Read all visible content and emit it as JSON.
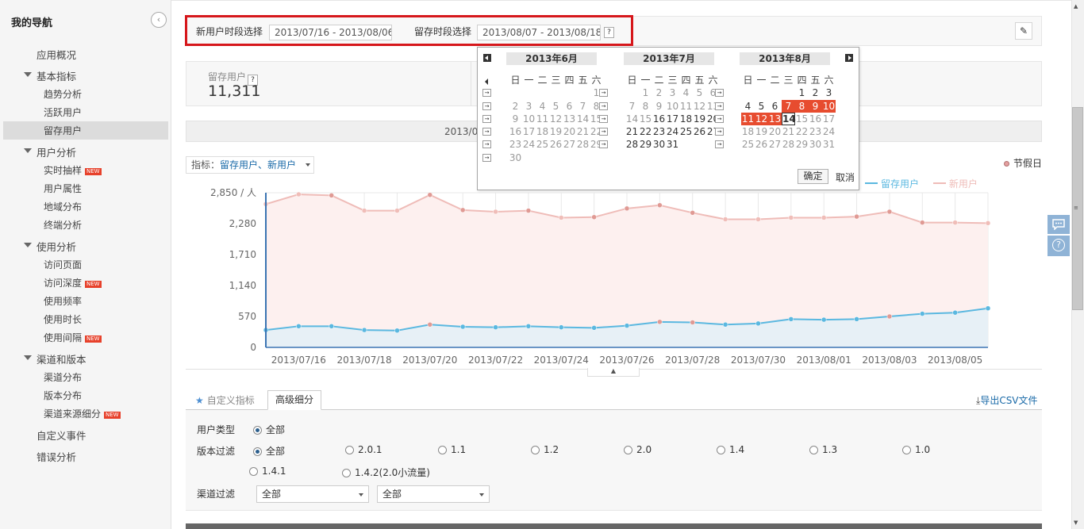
{
  "sidebar": {
    "title": "我的导航",
    "collapse_icon": "‹",
    "items": [
      {
        "label": "应用概况",
        "level": 1,
        "top": 59
      },
      {
        "label": "基本指标",
        "level": 1,
        "group": true,
        "top": 86
      },
      {
        "label": "趋势分析",
        "level": 2,
        "top": 110
      },
      {
        "label": "活跃用户",
        "level": 2,
        "top": 133
      },
      {
        "label": "留存用户",
        "level": 2,
        "active": true,
        "top": 156
      },
      {
        "label": "用户分析",
        "level": 1,
        "group": true,
        "top": 182
      },
      {
        "label": "实时抽样",
        "level": 2,
        "badge": "NEW",
        "top": 206
      },
      {
        "label": "用户属性",
        "level": 2,
        "top": 229
      },
      {
        "label": "地域分布",
        "level": 2,
        "top": 252
      },
      {
        "label": "终端分析",
        "level": 2,
        "top": 275
      },
      {
        "label": "使用分析",
        "level": 1,
        "group": true,
        "top": 301
      },
      {
        "label": "访问页面",
        "level": 2,
        "top": 325
      },
      {
        "label": "访问深度",
        "level": 2,
        "badge": "NEW",
        "top": 348
      },
      {
        "label": "使用频率",
        "level": 2,
        "top": 371
      },
      {
        "label": "使用时长",
        "level": 2,
        "top": 394
      },
      {
        "label": "使用间隔",
        "level": 2,
        "badge": "NEW",
        "top": 417
      },
      {
        "label": "渠道和版本",
        "level": 1,
        "group": true,
        "top": 443
      },
      {
        "label": "渠道分布",
        "level": 2,
        "top": 467
      },
      {
        "label": "版本分布",
        "level": 2,
        "top": 490
      },
      {
        "label": "渠道来源细分",
        "level": 2,
        "badge": "NEW",
        "top": 513
      },
      {
        "label": "自定义事件",
        "level": 1,
        "top": 539
      },
      {
        "label": "错误分析",
        "level": 1,
        "top": 566
      }
    ]
  },
  "filters": {
    "new_user_label": "新用户时段选择",
    "new_user_range": "2013/07/16 - 2013/08/06",
    "retention_label": "留存时段选择",
    "retention_range": "2013/08/07 - 2013/08/18",
    "help_icon": "?",
    "pin_icon": "✎"
  },
  "stat": {
    "label": "留存用户",
    "help_icon": "?",
    "value": "11,311"
  },
  "datebar_text": "2013/0",
  "metric": {
    "key": "指标：",
    "value": "留存用户、新用户"
  },
  "holiday_label": "节假日",
  "legend": {
    "retention": "留存用户",
    "new_users": "新用户"
  },
  "colors": {
    "retention": "#5bb8e0",
    "new_users": "#efbcb8",
    "accent_red": "#e74c2f",
    "link": "#1a6aa8"
  },
  "chart_data": {
    "type": "line",
    "y_ticks": [
      "0",
      "570",
      "1,140",
      "1,710",
      "2,280",
      "2,850 / 人"
    ],
    "ylim": [
      0,
      2850
    ],
    "x_ticks": [
      "2013/07/16",
      "2013/07/18",
      "2013/07/20",
      "2013/07/22",
      "2013/07/24",
      "2013/07/26",
      "2013/07/28",
      "2013/07/30",
      "2013/08/01",
      "2013/08/03",
      "2013/08/05"
    ],
    "x": [
      "2013/07/15",
      "2013/07/16",
      "2013/07/17",
      "2013/07/18",
      "2013/07/19",
      "2013/07/20",
      "2013/07/21",
      "2013/07/22",
      "2013/07/23",
      "2013/07/24",
      "2013/07/25",
      "2013/07/26",
      "2013/07/27",
      "2013/07/28",
      "2013/07/29",
      "2013/07/30",
      "2013/07/31",
      "2013/08/01",
      "2013/08/02",
      "2013/08/03",
      "2013/08/04",
      "2013/08/05",
      "2013/08/06"
    ],
    "series": [
      {
        "name": "新用户",
        "values": [
          2640,
          2820,
          2800,
          2520,
          2520,
          2810,
          2530,
          2500,
          2520,
          2390,
          2400,
          2560,
          2620,
          2480,
          2360,
          2360,
          2390,
          2390,
          2410,
          2500,
          2300,
          2300,
          2290
        ]
      },
      {
        "name": "留存用户",
        "values": [
          320,
          390,
          390,
          320,
          310,
          420,
          380,
          370,
          390,
          370,
          360,
          400,
          470,
          460,
          420,
          440,
          520,
          510,
          520,
          570,
          620,
          640,
          720
        ]
      }
    ],
    "holiday_points": {
      "新用户": [
        2,
        5,
        6,
        8,
        10,
        11,
        12,
        13,
        18,
        19,
        20
      ],
      "留存用户": [
        5,
        12,
        13,
        19
      ]
    }
  },
  "tabs": {
    "custom": "自定义指标",
    "advanced": "高级细分",
    "export": "导出CSV文件",
    "star_icon": "★",
    "download_icon": "⤓"
  },
  "filter_rows": {
    "user_type_label": "用户类型",
    "user_type_options": [
      {
        "label": "全部",
        "checked": true
      }
    ],
    "version_label": "版本过滤",
    "version_options": [
      {
        "label": "全部",
        "checked": true
      },
      {
        "label": "2.0.1"
      },
      {
        "label": "1.1"
      },
      {
        "label": "1.2"
      },
      {
        "label": "2.0"
      },
      {
        "label": "1.4"
      },
      {
        "label": "1.3"
      },
      {
        "label": "1.0"
      },
      {
        "label": "1.4.1"
      },
      {
        "label": "1.4.2(2.0小流量)"
      }
    ],
    "channel_label": "渠道过滤",
    "channel_select_1": "全部",
    "channel_select_2": "全部"
  },
  "calendar": {
    "weekdays": [
      "日",
      "一",
      "二",
      "三",
      "四",
      "五",
      "六"
    ],
    "months": [
      {
        "title": "2013年6月",
        "rows": [
          [
            "",
            "",
            "",
            "",
            "",
            "",
            "1"
          ],
          [
            "2",
            "3",
            "4",
            "5",
            "6",
            "7",
            "8"
          ],
          [
            "9",
            "10",
            "11",
            "12",
            "13",
            "14",
            "15"
          ],
          [
            "16",
            "17",
            "18",
            "19",
            "20",
            "21",
            "22"
          ],
          [
            "23",
            "24",
            "25",
            "26",
            "27",
            "28",
            "29"
          ],
          [
            "30",
            "",
            "",
            "",
            "",
            "",
            ""
          ]
        ],
        "gray_all": true
      },
      {
        "title": "2013年7月",
        "rows": [
          [
            "",
            "1",
            "2",
            "3",
            "4",
            "5",
            "6"
          ],
          [
            "7",
            "8",
            "9",
            "10",
            "11",
            "12",
            "13"
          ],
          [
            "14",
            "15",
            "16",
            "17",
            "18",
            "19",
            "20"
          ],
          [
            "21",
            "22",
            "23",
            "24",
            "25",
            "26",
            "27"
          ],
          [
            "28",
            "29",
            "30",
            "31",
            "",
            "",
            ""
          ]
        ],
        "gray_until": 16
      },
      {
        "title": "2013年8月",
        "rows": [
          [
            "",
            "",
            "",
            "",
            "1",
            "2",
            "3"
          ],
          [
            "4",
            "5",
            "6",
            "7",
            "8",
            "9",
            "10"
          ],
          [
            "11",
            "12",
            "13",
            "14",
            "15",
            "16",
            "17"
          ],
          [
            "18",
            "19",
            "20",
            "21",
            "22",
            "23",
            "24"
          ],
          [
            "25",
            "26",
            "27",
            "28",
            "29",
            "30",
            "31"
          ]
        ],
        "selected": [
          7,
          8,
          9,
          10,
          11,
          12,
          13
        ],
        "today": 14,
        "gray_from": 15
      }
    ],
    "week_icon": "→",
    "ok_label": "确定",
    "cancel_label": "取消"
  },
  "side_buttons": {
    "chat_icon": "💬",
    "help_icon": "?"
  }
}
